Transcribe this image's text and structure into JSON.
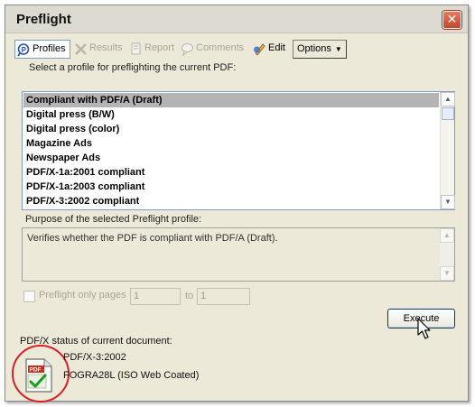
{
  "window": {
    "title": "Preflight"
  },
  "toolbar": {
    "profiles": "Profiles",
    "results": "Results",
    "report": "Report",
    "comments": "Comments",
    "edit": "Edit",
    "options": "Options"
  },
  "instruction": "Select a profile for preflighting the current PDF:",
  "profiles": [
    "Compliant with PDF/A (Draft)",
    "Digital press (B/W)",
    "Digital press (color)",
    "Magazine Ads",
    "Newspaper Ads",
    "PDF/X-1a:2001 compliant",
    "PDF/X-1a:2003 compliant",
    "PDF/X-3:2002 compliant"
  ],
  "selected_profile_index": 0,
  "purpose": {
    "label": "Purpose of the selected Preflight profile:",
    "text": "Verifies whether the PDF is compliant with PDF/A (Draft)."
  },
  "page_range": {
    "checkbox_label": "Preflight only pages",
    "from": "1",
    "to_label": "to",
    "to": "1"
  },
  "execute_label": "Execute",
  "status": {
    "label": "PDF/X status of current document:",
    "line1": "PDF/X-3:2002",
    "line2": "FOGRA28L (ISO Web Coated)"
  },
  "colors": {
    "highlight_circle": "#d81e24",
    "selected_row": "#b4b4b4"
  },
  "icons": [
    "profiles-icon",
    "results-icon",
    "report-icon",
    "comments-icon",
    "edit-icon",
    "close-icon",
    "pdf-check-icon",
    "mouse-cursor-icon"
  ]
}
